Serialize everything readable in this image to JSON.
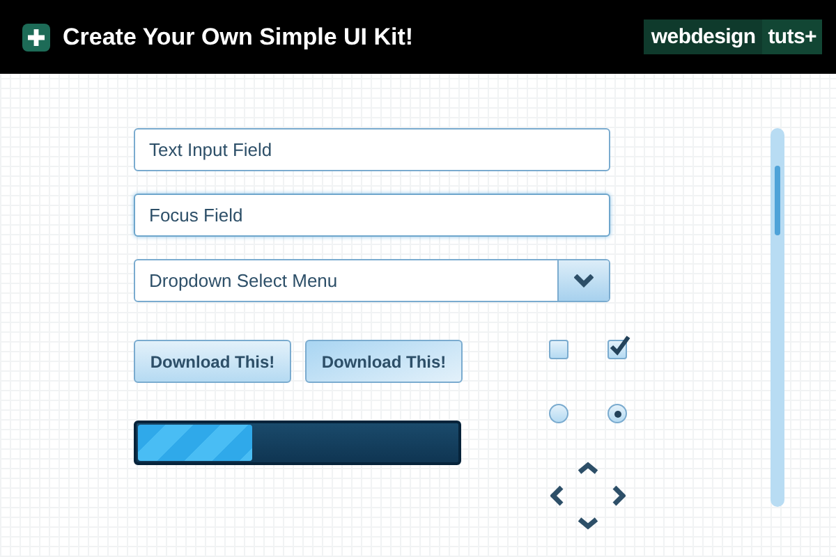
{
  "header": {
    "title": "Create Your Own Simple UI Kit!",
    "logo": [
      "webdesign",
      "tuts+"
    ]
  },
  "fields": [
    {
      "value": "Text Input Field",
      "focused": false
    },
    {
      "value": "Focus Field",
      "focused": true
    }
  ],
  "dropdown": {
    "value": "Dropdown Select Menu"
  },
  "buttons": [
    {
      "label": "Download This!",
      "hover": false
    },
    {
      "label": "Download This!",
      "hover": true
    }
  ],
  "progress": {
    "level": 0.36
  },
  "checkboxes": [
    {
      "checked": false
    },
    {
      "checked": true
    }
  ],
  "radios": [
    {
      "selected": false
    },
    {
      "selected": true
    }
  ]
}
